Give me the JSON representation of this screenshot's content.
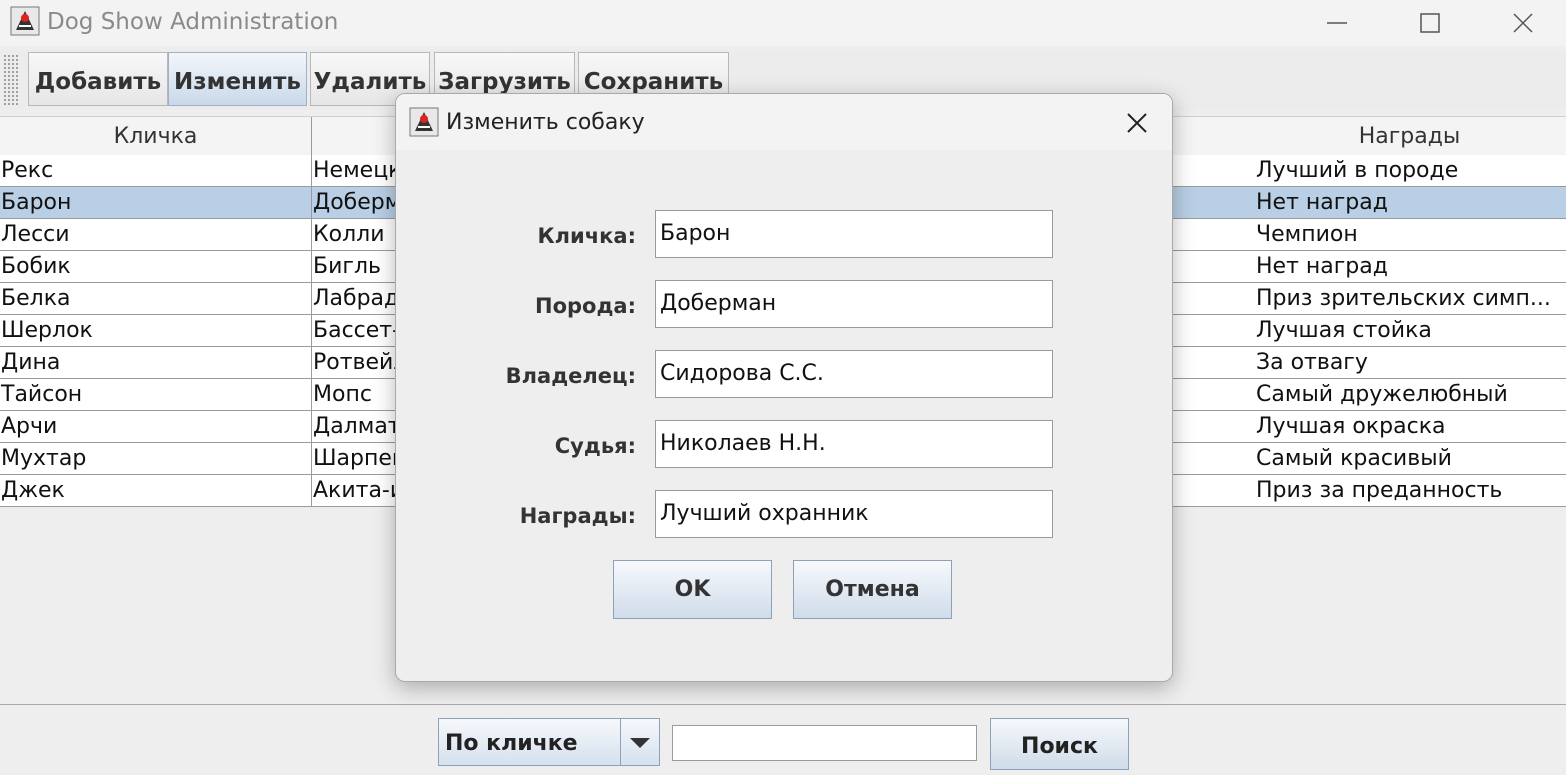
{
  "window": {
    "title": "Dog Show Administration"
  },
  "toolbar": {
    "add": "Добавить",
    "edit": "Изменить",
    "delete": "Удалить",
    "load": "Загрузить",
    "save": "Сохранить"
  },
  "table": {
    "headers": [
      "Кличка",
      "",
      "",
      "",
      "Награды"
    ],
    "rows": [
      {
        "name": "Рекс",
        "breed": "Немецк",
        "awards": "Лучший в породе"
      },
      {
        "name": "Барон",
        "breed": "Доберм",
        "awards": "Нет наград",
        "selected": true
      },
      {
        "name": "Лесси",
        "breed": "Колли",
        "awards": "Чемпион"
      },
      {
        "name": "Бобик",
        "breed": "Бигль",
        "awards": "Нет наград"
      },
      {
        "name": "Белка",
        "breed": "Лабрад",
        "awards": "Приз зрительских симп..."
      },
      {
        "name": "Шерлок",
        "breed": "Бассет-",
        "awards": "Лучшая стойка"
      },
      {
        "name": "Дина",
        "breed": "Ротвейл",
        "awards": "За отвагу"
      },
      {
        "name": "Тайсон",
        "breed": "Мопс",
        "awards": "Самый дружелюбный"
      },
      {
        "name": "Арчи",
        "breed": "Далмат",
        "awards": "Лучшая окраска"
      },
      {
        "name": "Мухтар",
        "breed": "Шарпей",
        "awards": "Самый красивый"
      },
      {
        "name": "Джек",
        "breed": "Акита-и",
        "awards": "Приз за преданность"
      }
    ]
  },
  "search": {
    "mode": "По кличке",
    "query": "",
    "button": "Поиск"
  },
  "dialog": {
    "title": "Изменить собаку",
    "fields": [
      {
        "label": "Кличка:",
        "value": "Барон"
      },
      {
        "label": "Порода:",
        "value": "Доберман"
      },
      {
        "label": "Владелец:",
        "value": "Сидорова С.С."
      },
      {
        "label": "Судья:",
        "value": "Николаев Н.Н."
      },
      {
        "label": "Награды:",
        "value": "Лучший охранник"
      }
    ],
    "ok": "OK",
    "cancel": "Отмена"
  },
  "colors": {
    "selection": "#b8cfe5",
    "button_gradient_end": "#cfdcea"
  }
}
